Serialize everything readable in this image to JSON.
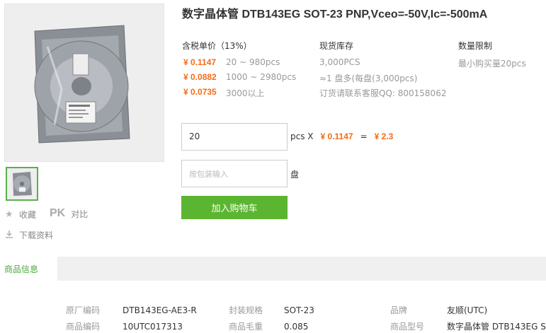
{
  "product": {
    "title": "数字晶体管 DTB143EG SOT-23 PNP,Vceo=-50V,Ic=-500mA"
  },
  "actions": {
    "favorite": "收藏",
    "pk": "PK",
    "compare": "对比",
    "download": "下载资料"
  },
  "price": {
    "header": "含税单价（13%）",
    "tiers": [
      {
        "price": "¥ 0.1147",
        "qty": "20 ~ 980pcs"
      },
      {
        "price": "¥ 0.0882",
        "qty": "1000 ~ 2980pcs"
      },
      {
        "price": "¥ 0.0735",
        "qty": "3000以上"
      }
    ]
  },
  "stock": {
    "header": "现货库存",
    "count": "3,000PCS",
    "reel": "≈1 盘多(每盘(3,000pcs)",
    "contact": "订货请联系客服QQ: 800158062"
  },
  "limit": {
    "header": "数量限制",
    "text": "最小购买量20pcs"
  },
  "order": {
    "qty_value": "20",
    "unit": "pcs X",
    "unit_price": "¥ 0.1147",
    "equals": "=",
    "total": "¥ 2.3",
    "reel_placeholder": "按包装输入",
    "reel_unit": "盘",
    "cart_button": "加入购物车"
  },
  "tabs": {
    "active": "商品信息"
  },
  "specs": {
    "row1": [
      {
        "label": "原厂编码",
        "value": "DTB143EG-AE3-R"
      },
      {
        "label": "封装规格",
        "value": "SOT-23"
      },
      {
        "label": "品牌",
        "value": "友顺(UTC)"
      }
    ],
    "row2": [
      {
        "label": "商品编码",
        "value": "10UTC017313"
      },
      {
        "label": "商品毛重",
        "value": "0.085"
      },
      {
        "label": "商品型号",
        "value": "数字晶体管 DTB143EG S..."
      }
    ]
  },
  "colors": {
    "accent_green": "#5cb531",
    "price_orange": "#f56b16"
  }
}
